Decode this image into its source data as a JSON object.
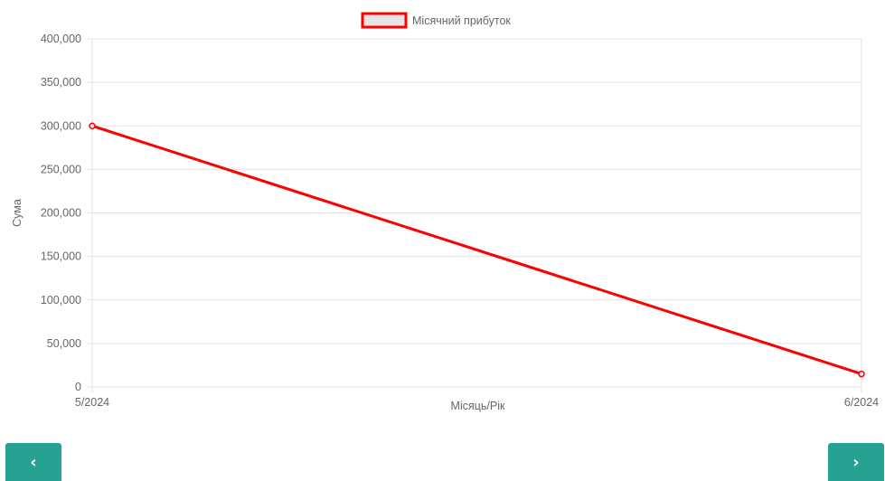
{
  "chart_data": {
    "type": "line",
    "title": "",
    "xlabel": "Місяць/Рік",
    "ylabel": "Сума",
    "categories": [
      "5/2024",
      "6/2024"
    ],
    "series": [
      {
        "name": "Місячний прибуток",
        "values": [
          300000,
          15000
        ],
        "color": "#ff0000"
      }
    ],
    "ylim": [
      0,
      400000
    ],
    "yticks": [
      "0",
      "50,000",
      "100,000",
      "150,000",
      "200,000",
      "250,000",
      "300,000",
      "350,000",
      "400,000"
    ],
    "grid": true,
    "legend_position": "top-center"
  },
  "navigation": {
    "prev_icon": "chevron-left-icon",
    "prev_label": "‹",
    "next_icon": "chevron-right-icon",
    "next_label": "›"
  }
}
